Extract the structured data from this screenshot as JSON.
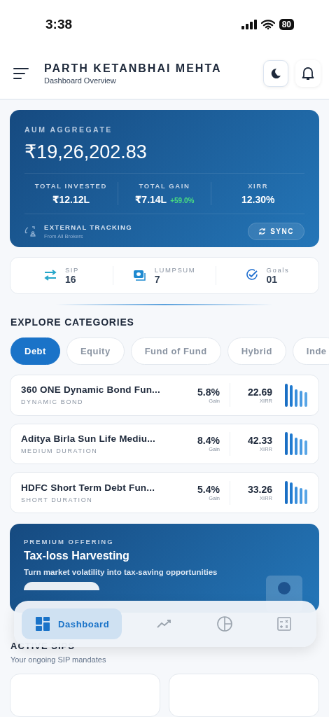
{
  "status_bar": {
    "time": "3:38",
    "battery": "80"
  },
  "header": {
    "title": "PARTH KETANBHAI MEHTA",
    "subtitle": "Dashboard Overview"
  },
  "aum_card": {
    "label": "AUM AGGREGATE",
    "value": "₹19,26,202.83",
    "metrics": [
      {
        "label": "TOTAL INVESTED",
        "value": "₹12.12L"
      },
      {
        "label": "TOTAL GAIN",
        "value": "₹7.14L",
        "change": "+59.0%"
      },
      {
        "label": "XIRR",
        "value": "12.30%"
      }
    ],
    "tracking": {
      "title": "EXTERNAL TRACKING",
      "subtitle": "From All Brokers"
    },
    "sync_button": "SYNC"
  },
  "summary": [
    {
      "kind": "sip",
      "label": "SIP",
      "value": "16"
    },
    {
      "kind": "lumpsum",
      "label": "LUMPSUM",
      "value": "7"
    },
    {
      "kind": "goals",
      "label": "Goals",
      "value": "01"
    }
  ],
  "categories": {
    "title": "EXPLORE CATEGORIES",
    "tabs": [
      {
        "label": "Debt",
        "selected": true
      },
      {
        "label": "Equity",
        "selected": false
      },
      {
        "label": "Fund of Fund",
        "selected": false
      },
      {
        "label": "Hybrid",
        "selected": false
      },
      {
        "label": "Inde",
        "selected": false
      }
    ]
  },
  "funds": [
    {
      "name": "360 ONE Dynamic Bond Fun...",
      "category": "DYNAMIC BOND",
      "gain": "5.8%",
      "gain_label": "Gain",
      "xirr": "22.69",
      "xirr_label": "XIRR"
    },
    {
      "name": "Aditya Birla Sun Life Mediu...",
      "category": "MEDIUM DURATION",
      "gain": "8.4%",
      "gain_label": "Gain",
      "xirr": "42.33",
      "xirr_label": "XIRR"
    },
    {
      "name": "HDFC Short Term Debt Fun...",
      "category": "SHORT DURATION",
      "gain": "5.4%",
      "gain_label": "Gain",
      "xirr": "33.26",
      "xirr_label": "XIRR"
    }
  ],
  "promo": {
    "eyebrow": "PREMIUM OFFERING",
    "title": "Tax-loss Harvesting",
    "text": "Turn market volatility into tax-saving opportunities"
  },
  "active_sips": {
    "title": "ACTIVE SIPS",
    "subtitle": "Your ongoing SIP mandates"
  },
  "bottom_nav": [
    {
      "kind": "dashboard",
      "label": "Dashboard",
      "selected": true
    },
    {
      "kind": "trend",
      "selected": false
    },
    {
      "kind": "pie",
      "selected": false
    },
    {
      "kind": "calculator",
      "selected": false
    }
  ]
}
